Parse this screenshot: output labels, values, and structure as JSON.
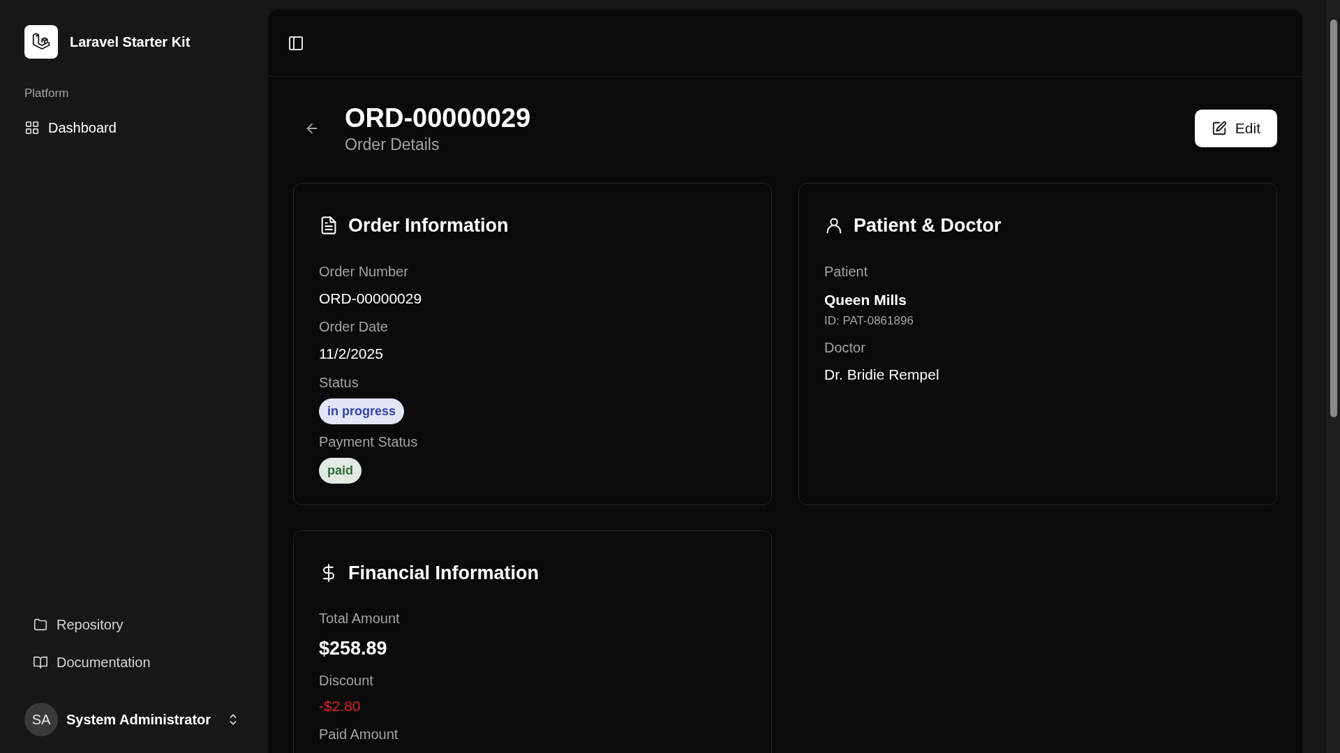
{
  "sidebar": {
    "app_name": "Laravel Starter Kit",
    "group_label": "Platform",
    "nav": [
      {
        "label": "Dashboard",
        "kind": "grid"
      }
    ],
    "footer_links": [
      {
        "label": "Repository",
        "kind": "folder"
      },
      {
        "label": "Documentation",
        "kind": "book"
      }
    ],
    "user": {
      "initials": "SA",
      "name": "System Administrator"
    }
  },
  "header": {
    "title": "ORD-00000029",
    "subtitle": "Order Details",
    "edit_button": "Edit"
  },
  "cards": [
    {
      "title": "Order Information",
      "kind": "file",
      "fields": [
        {
          "kind": "label",
          "text": "Order Number"
        },
        {
          "kind": "text",
          "text": "ORD-00000029"
        },
        {
          "kind": "label",
          "text": "Order Date"
        },
        {
          "kind": "text",
          "text": "11/2/2025"
        },
        {
          "kind": "label",
          "text": "Status"
        },
        {
          "kind": "badge",
          "text": "in progress",
          "color": "#3344aa"
        },
        {
          "kind": "label",
          "text": "Payment Status"
        },
        {
          "kind": "badge",
          "text": "paid",
          "color": "#2f6b3a"
        }
      ]
    },
    {
      "title": "Patient & Doctor",
      "kind": "user",
      "fields": [
        {
          "kind": "label",
          "text": "Patient"
        },
        {
          "kind": "strong",
          "text": "Queen Mills"
        },
        {
          "kind": "sub",
          "text": "ID: PAT-0861896"
        },
        {
          "kind": "label",
          "text": "Doctor"
        },
        {
          "kind": "text",
          "text": "Dr. Bridie Rempel"
        }
      ]
    },
    {
      "title": "Financial Information",
      "kind": "dollar",
      "fields": [
        {
          "kind": "label",
          "text": "Total Amount"
        },
        {
          "kind": "amount",
          "text": "$258.89"
        },
        {
          "kind": "label",
          "text": "Discount"
        },
        {
          "kind": "negative",
          "text": "-$2.80"
        },
        {
          "kind": "label",
          "text": "Paid Amount"
        }
      ]
    }
  ]
}
